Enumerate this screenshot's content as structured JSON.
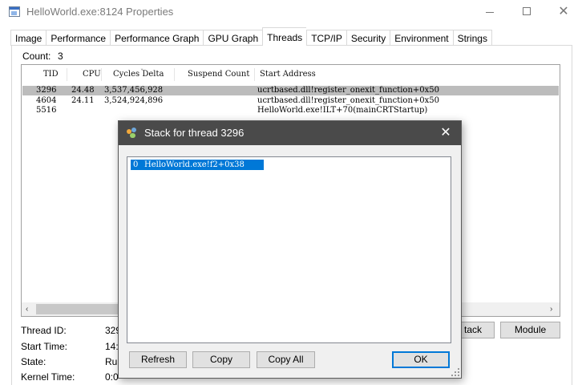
{
  "window": {
    "title": "HelloWorld.exe:8124 Properties",
    "close_glyph": "✕"
  },
  "tabs": [
    {
      "label": "Image"
    },
    {
      "label": "Performance"
    },
    {
      "label": "Performance Graph"
    },
    {
      "label": "GPU Graph"
    },
    {
      "label": "Threads",
      "active": true
    },
    {
      "label": "TCP/IP"
    },
    {
      "label": "Security"
    },
    {
      "label": "Environment"
    },
    {
      "label": "Strings"
    }
  ],
  "threads": {
    "count_label": "Count:",
    "count_value": "3",
    "columns": [
      "TID",
      "CPU",
      "Cycles Delta",
      "Suspend Count",
      "Start Address"
    ],
    "rows": [
      {
        "tid": "3296",
        "cpu": "24.48",
        "cycles": "3,537,456,928",
        "suspend": "",
        "start": "ucrtbased.dll!register_onexit_function+0x50",
        "selected": true
      },
      {
        "tid": "4604",
        "cpu": "24.11",
        "cycles": "3,524,924,896",
        "suspend": "",
        "start": "ucrtbased.dll!register_onexit_function+0x50",
        "selected": false
      },
      {
        "tid": "5516",
        "cpu": "",
        "cycles": "",
        "suspend": "",
        "start": "HelloWorld.exe!ILT+70(mainCRTStartup)",
        "selected": false
      }
    ],
    "scroll_left": "‹",
    "scroll_right": "›"
  },
  "details": {
    "thread_id_label": "Thread ID:",
    "thread_id_value": "329",
    "start_time_label": "Start Time:",
    "start_time_value": "14:",
    "state_label": "State:",
    "state_value": "Run",
    "kernel_time_label": "Kernel Time:",
    "kernel_time_value": "0:0",
    "stack_button": "tack",
    "module_button": "Module"
  },
  "dialog": {
    "title": "Stack for thread 3296",
    "close_glyph": "✕",
    "frames": [
      {
        "index": "0",
        "function": "HelloWorld.exe!f2+0x38"
      }
    ],
    "refresh_button": "Refresh",
    "copy_button": "Copy",
    "copy_all_button": "Copy All",
    "ok_button": "OK"
  }
}
